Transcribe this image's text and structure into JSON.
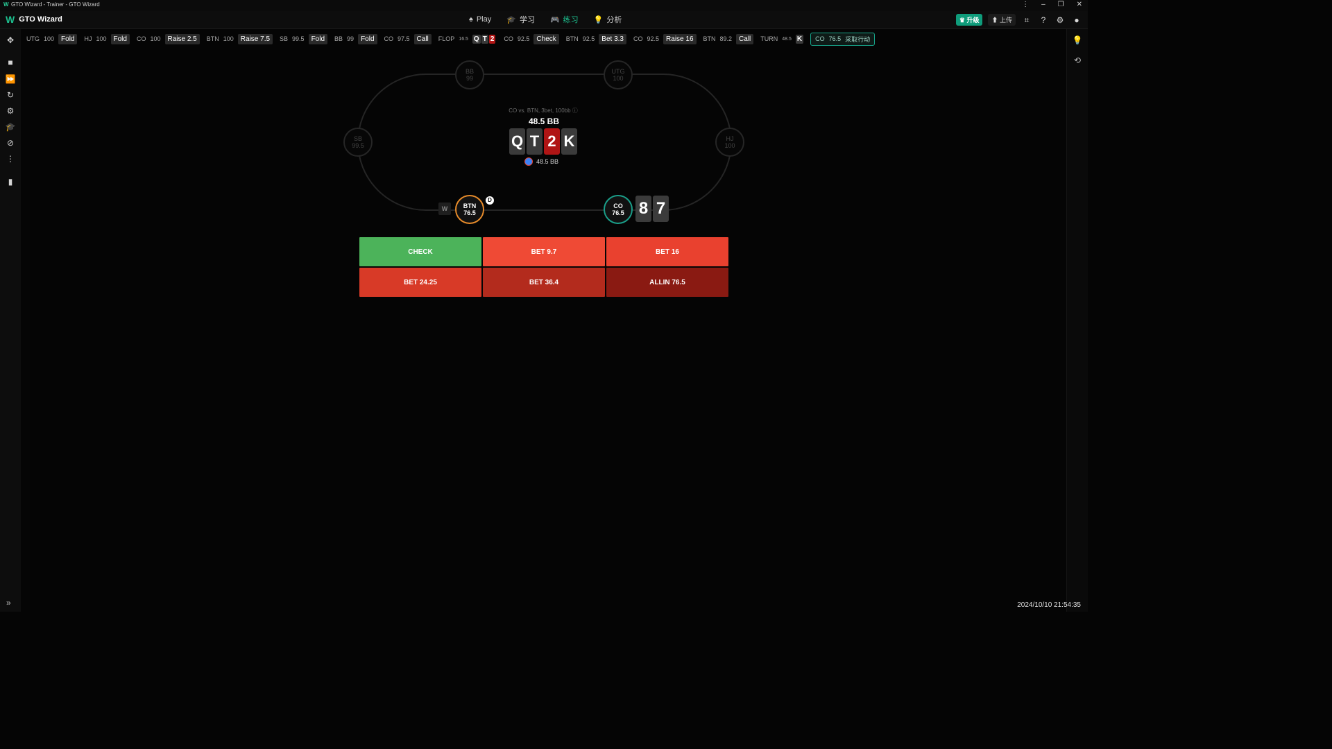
{
  "window": {
    "title": "GTO Wizard - Trainer - GTO Wizard"
  },
  "app": {
    "name": "GTO Wizard",
    "nav": [
      {
        "label": "Play",
        "icon": "poker-chip-icon",
        "active": false
      },
      {
        "label": "学习",
        "icon": "graduation-cap-icon",
        "active": false
      },
      {
        "label": "练习",
        "icon": "gamepad-icon",
        "active": true
      },
      {
        "label": "分析",
        "icon": "lightbulb-icon",
        "active": false
      }
    ],
    "upgrade_label": "升级",
    "upload_label": "上传"
  },
  "action_bar": {
    "entries": [
      {
        "pos": "UTG",
        "stack": "100",
        "action": "Fold"
      },
      {
        "pos": "HJ",
        "stack": "100",
        "action": "Fold"
      },
      {
        "pos": "CO",
        "stack": "100",
        "action": "Raise 2.5"
      },
      {
        "pos": "BTN",
        "stack": "100",
        "action": "Raise 7.5"
      },
      {
        "pos": "SB",
        "stack": "99.5",
        "action": "Fold"
      },
      {
        "pos": "BB",
        "stack": "99",
        "action": "Fold"
      },
      {
        "pos": "CO",
        "stack": "97.5",
        "action": "Call"
      }
    ],
    "flop": {
      "label": "FLOP",
      "pot": "16.5",
      "cards": [
        "Q",
        "T",
        "2"
      ]
    },
    "flop_entries": [
      {
        "pos": "CO",
        "stack": "92.5",
        "action": "Check"
      },
      {
        "pos": "BTN",
        "stack": "92.5",
        "action": "Bet 3.3"
      },
      {
        "pos": "CO",
        "stack": "92.5",
        "action": "Raise 16"
      },
      {
        "pos": "BTN",
        "stack": "89.2",
        "action": "Call"
      }
    ],
    "turn": {
      "label": "TURN",
      "pot": "48.5",
      "card": "K"
    },
    "current": {
      "pos": "CO",
      "stack": "76.5",
      "label": "采取行动"
    }
  },
  "table": {
    "scenario": "CO vs. BTN, 3bet, 100bb",
    "pot_label": "48.5 BB",
    "pot_chip_label": "48.5 BB",
    "board": [
      {
        "rank": "Q",
        "color": "#3b3b3b"
      },
      {
        "rank": "T",
        "color": "#3b3b3b"
      },
      {
        "rank": "2",
        "color": "#b01515"
      },
      {
        "rank": "K",
        "color": "#3b3b3b"
      }
    ],
    "seats": {
      "bb": {
        "pos": "BB",
        "stack": "99"
      },
      "utg": {
        "pos": "UTG",
        "stack": "100"
      },
      "sb": {
        "pos": "SB",
        "stack": "99.5"
      },
      "hj": {
        "pos": "HJ",
        "stack": "100"
      },
      "btn": {
        "pos": "BTN",
        "stack": "76.5"
      },
      "co": {
        "pos": "CO",
        "stack": "76.5"
      }
    },
    "dealer_label": "D",
    "villain_badge": "W",
    "hero_cards": [
      "8",
      "7"
    ]
  },
  "actions": [
    {
      "label": "CHECK",
      "color": "#4cb35a"
    },
    {
      "label": "BET 9.7",
      "color": "#ef4a35"
    },
    {
      "label": "BET 16",
      "color": "#e9412f"
    },
    {
      "label": "BET 24.25",
      "color": "#d83a27"
    },
    {
      "label": "BET 36.4",
      "color": "#b32b1d"
    },
    {
      "label": "ALLIN 76.5",
      "color": "#8a1a12"
    }
  ],
  "timestamp": "2024/10/10 21:54:35"
}
